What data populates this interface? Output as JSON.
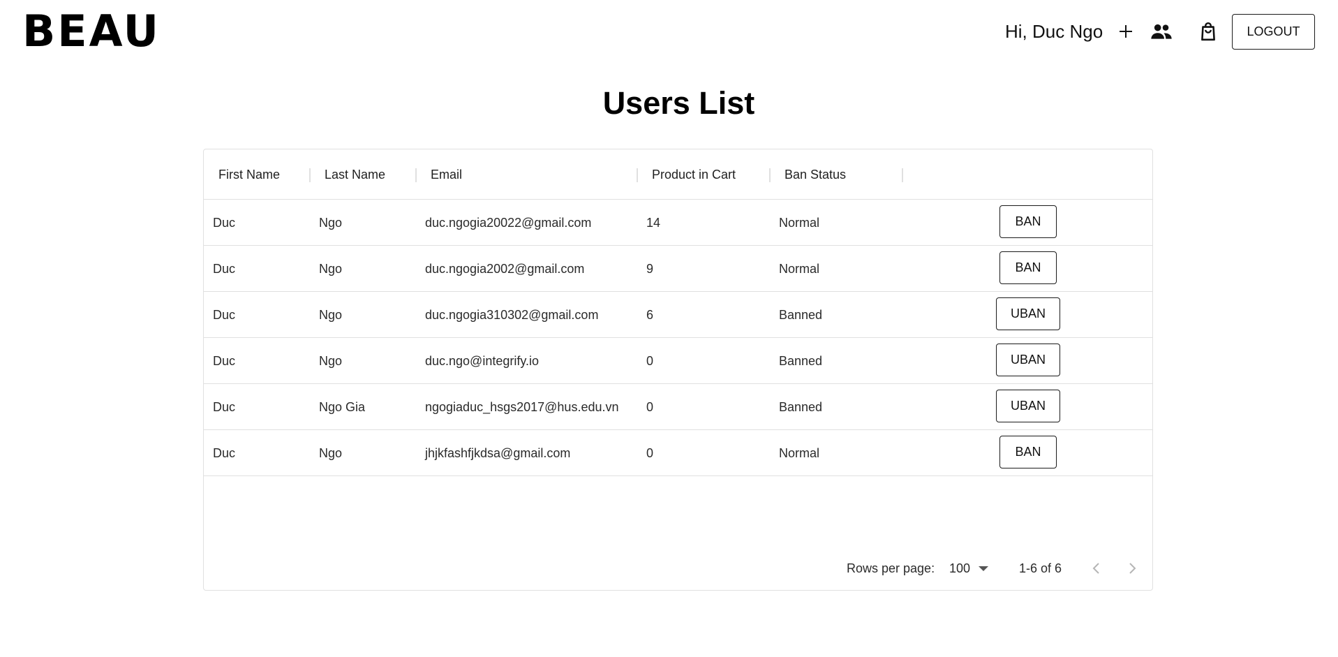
{
  "header": {
    "logo": "BEAU",
    "greeting": "Hi, Duc Ngo",
    "add_icon": "plus-icon",
    "users_icon": "people-icon",
    "cart_icon": "shopping-bag-icon",
    "logout_label": "LOGOUT"
  },
  "page": {
    "title": "Users List"
  },
  "table": {
    "columns": [
      "First Name",
      "Last Name",
      "Email",
      "Product in Cart",
      "Ban Status"
    ],
    "rows": [
      {
        "first": "Duc",
        "last": "Ngo",
        "email": "duc.ngogia20022@gmail.com",
        "cart": "14",
        "status": "Normal",
        "action": "BAN"
      },
      {
        "first": "Duc",
        "last": "Ngo",
        "email": "duc.ngogia2002@gmail.com",
        "cart": "9",
        "status": "Normal",
        "action": "BAN"
      },
      {
        "first": "Duc",
        "last": "Ngo",
        "email": "duc.ngogia310302@gmail.com",
        "cart": "6",
        "status": "Banned",
        "action": "UBAN"
      },
      {
        "first": "Duc",
        "last": "Ngo",
        "email": "duc.ngo@integrify.io",
        "cart": "0",
        "status": "Banned",
        "action": "UBAN"
      },
      {
        "first": "Duc",
        "last": "Ngo Gia",
        "email": "ngogiaduc_hsgs2017@hus.edu.vn",
        "cart": "0",
        "status": "Banned",
        "action": "UBAN"
      },
      {
        "first": "Duc",
        "last": "Ngo",
        "email": "jhjkfashfjkdsa@gmail.com",
        "cart": "0",
        "status": "Normal",
        "action": "BAN"
      }
    ]
  },
  "pagination": {
    "rows_per_page_label": "Rows per page:",
    "rows_per_page_value": "100",
    "range": "1-6 of 6"
  }
}
